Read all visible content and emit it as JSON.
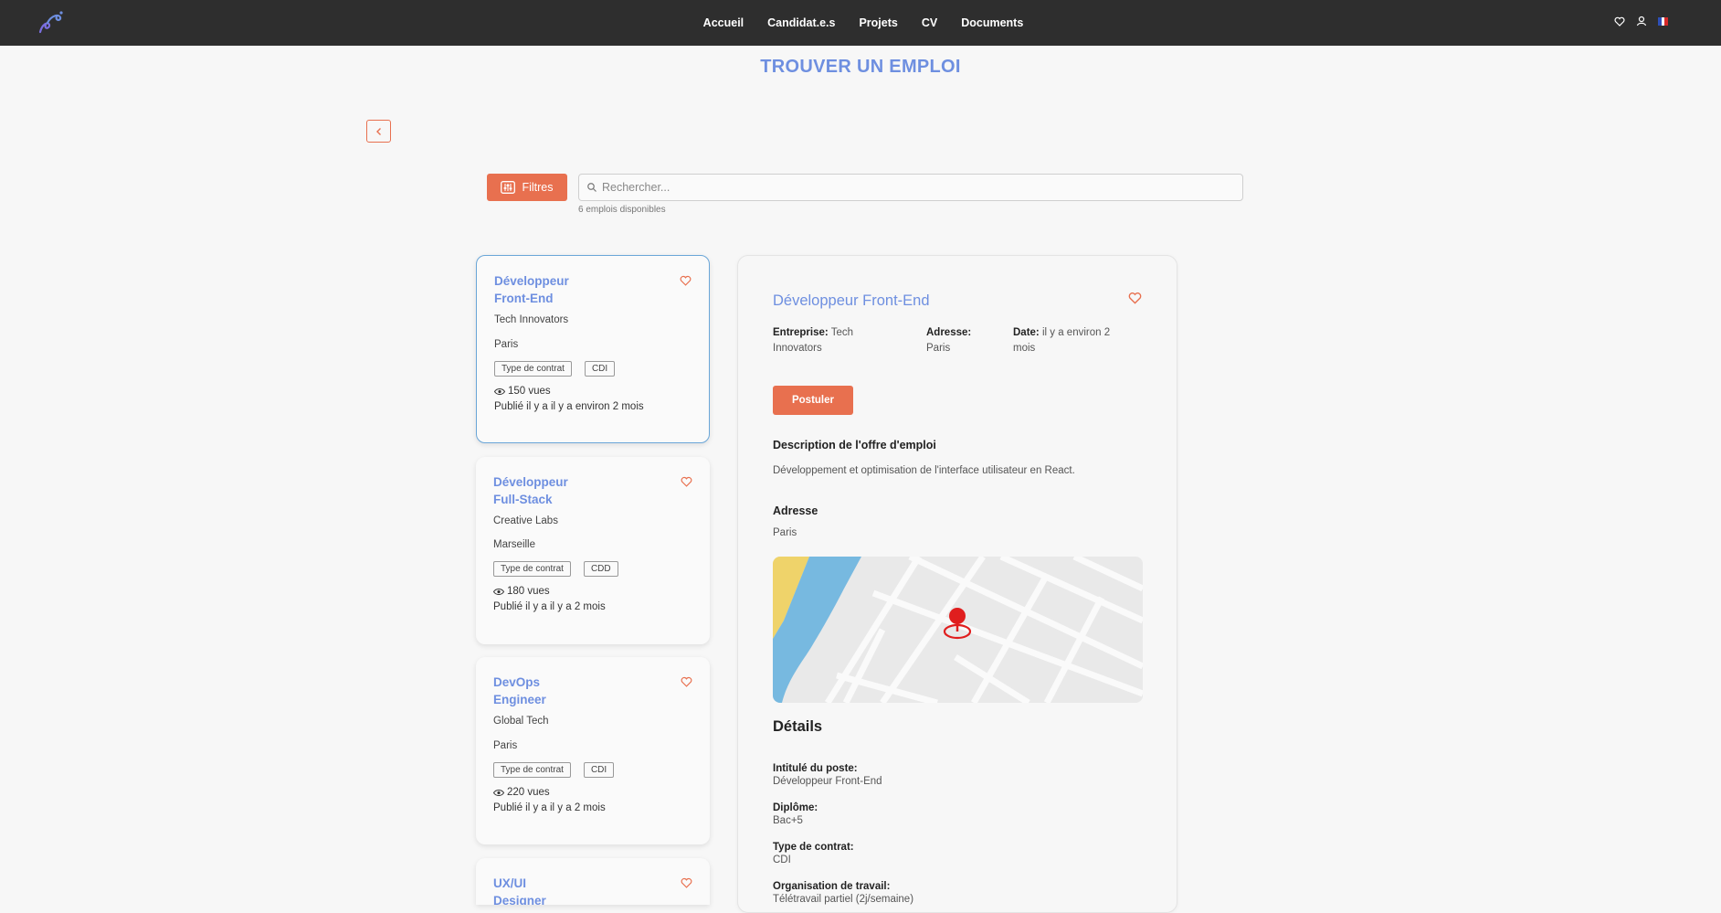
{
  "nav": {
    "items": [
      "Accueil",
      "Candidat.e.s",
      "Projets",
      "CV",
      "Documents"
    ]
  },
  "page": {
    "title": "TROUVER UN EMPLOI"
  },
  "toolbar": {
    "filters_label": "Filtres",
    "search_placeholder": "Rechercher...",
    "count_text": "6 emplois disponibles"
  },
  "jobs": [
    {
      "title": "Développeur Front-End",
      "company": "Tech Innovators",
      "city": "Paris",
      "contract_label": "Type de contrat",
      "contract": "CDI",
      "views": "150 vues",
      "published": "Publié il y a il y a environ 2 mois"
    },
    {
      "title": "Développeur Full-Stack",
      "company": "Creative Labs",
      "city": "Marseille",
      "contract_label": "Type de contrat",
      "contract": "CDD",
      "views": "180 vues",
      "published": "Publié il y a il y a 2 mois"
    },
    {
      "title": "DevOps Engineer",
      "company": "Global Tech",
      "city": "Paris",
      "contract_label": "Type de contrat",
      "contract": "CDI",
      "views": "220 vues",
      "published": "Publié il y a il y a 2 mois"
    },
    {
      "title": "UX/UI Designer"
    }
  ],
  "detail": {
    "title": "Développeur Front-End",
    "company_label": "Entreprise:",
    "company": "Tech Innovators",
    "address_label": "Adresse:",
    "address": "Paris",
    "date_label": "Date:",
    "date": "il y a environ 2 mois",
    "apply_label": "Postuler",
    "description_heading": "Description de l'offre d'emploi",
    "description": "Développement et optimisation de l'interface utilisateur en React.",
    "address_heading": "Adresse",
    "address_value": "Paris",
    "details_heading": "Détails",
    "fields": [
      {
        "label": "Intitulé du poste:",
        "value": "Développeur Front-End"
      },
      {
        "label": "Diplôme:",
        "value": "Bac+5"
      },
      {
        "label": "Type de contrat:",
        "value": "CDI"
      },
      {
        "label": "Organisation de travail:",
        "value": "Télétravail partiel (2j/semaine)"
      }
    ]
  },
  "colors": {
    "accent": "#e8704f",
    "title_blue": "#6e8fe0",
    "nav_bg": "#2e2e2e"
  }
}
